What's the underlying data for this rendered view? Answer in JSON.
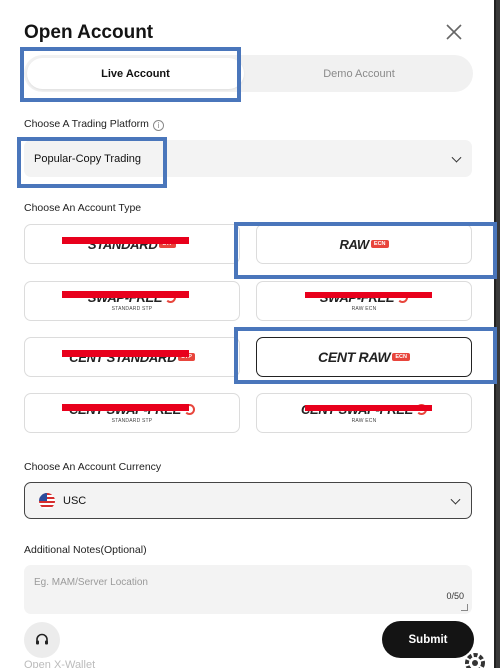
{
  "title": "Open Account",
  "tabs": [
    {
      "label": "Live Account",
      "active": true
    },
    {
      "label": "Demo Account",
      "active": false
    }
  ],
  "platform": {
    "label": "Choose A Trading Platform",
    "value": "Popular-Copy Trading"
  },
  "account_type": {
    "label": "Choose An Account Type",
    "options": [
      {
        "name": "STANDARD",
        "badge": "STP",
        "sub": "",
        "selected": false,
        "struck": true
      },
      {
        "name": "RAW",
        "badge": "ECN",
        "sub": "",
        "selected": false,
        "struck": false
      },
      {
        "name": "SWAP-FREE",
        "badge": "",
        "sub": "STANDARD STP",
        "selected": false,
        "struck": true
      },
      {
        "name": "SWAP-FREE",
        "badge": "",
        "sub": "RAW ECN",
        "selected": false,
        "struck": true
      },
      {
        "name": "CENT STANDARD",
        "badge": "STP",
        "sub": "",
        "selected": false,
        "struck": true
      },
      {
        "name": "CENT RAW",
        "badge": "ECN",
        "sub": "",
        "selected": true,
        "struck": false
      },
      {
        "name": "CENT SWAP-FREE",
        "badge": "",
        "sub": "STANDARD STP",
        "selected": false,
        "struck": true
      },
      {
        "name": "CENT SWAP-FREE",
        "badge": "",
        "sub": "RAW ECN",
        "selected": false,
        "struck": true
      }
    ]
  },
  "currency": {
    "label": "Choose An Account Currency",
    "value": "USC",
    "flag_icon": "us-flag-icon"
  },
  "notes": {
    "label": "Additional Notes(Optional)",
    "placeholder": "Eg. MAM/Server Location",
    "counter": "0/50"
  },
  "submit_label": "Submit",
  "wallet_label": "Open X-Wallet",
  "colors": {
    "highlight": "#4a76bb",
    "strike": "#e8001c",
    "brand_red": "#e8453c",
    "submit_bg": "#141414"
  }
}
